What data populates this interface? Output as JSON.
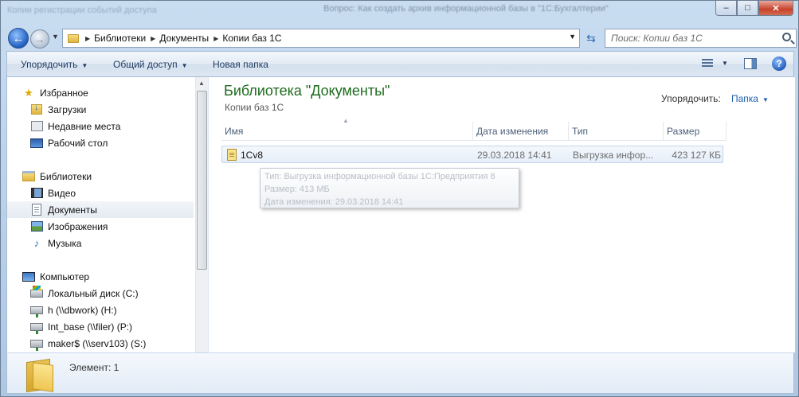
{
  "window": {
    "bg_title_left": "Копии регистрации событий доступа",
    "bg_title_right": "Вопрос: Как создать архив информационной базы в \"1С:Бухгалтерии\"",
    "caption": {
      "minimize": "‒",
      "maximize": "□",
      "close": "✕"
    }
  },
  "address": {
    "crumbs": [
      "Библиотеки",
      "Документы",
      "Копии баз 1С"
    ]
  },
  "search": {
    "placeholder": "Поиск: Копии баз 1С"
  },
  "toolbar": {
    "organize": "Упорядочить",
    "share": "Общий доступ",
    "new_folder": "Новая папка"
  },
  "nav": {
    "favorites": "Избранное",
    "downloads": "Загрузки",
    "recent": "Недавние места",
    "desktop": "Рабочий стол",
    "libraries": "Библиотеки",
    "video": "Видео",
    "documents": "Документы",
    "images": "Изображения",
    "music": "Музыка",
    "computer": "Компьютер",
    "drive_c": "Локальный диск (C:)",
    "drive_h": "h (\\\\dbwork) (H:)",
    "drive_p": "Int_base (\\\\filer) (P:)",
    "drive_s": "maker$ (\\\\serv103) (S:)"
  },
  "content": {
    "title": "Библиотека \"Документы\"",
    "subtitle": "Копии баз 1С",
    "arrange_label": "Упорядочить:",
    "arrange_value": "Папка"
  },
  "columns": {
    "name": "Имя",
    "date": "Дата изменения",
    "type": "Тип",
    "size": "Размер"
  },
  "files": [
    {
      "name": "1Cv8",
      "date": "29.03.2018 14:41",
      "type": "Выгрузка инфор...",
      "size": "423 127 КБ"
    }
  ],
  "tooltip": {
    "type": "Тип: Выгрузка информационной базы 1С:Предприятия 8",
    "size": "Размер: 413 МБ",
    "date": "Дата изменения: 29.03.2018 14:41"
  },
  "details": {
    "count": "Элемент: 1"
  }
}
